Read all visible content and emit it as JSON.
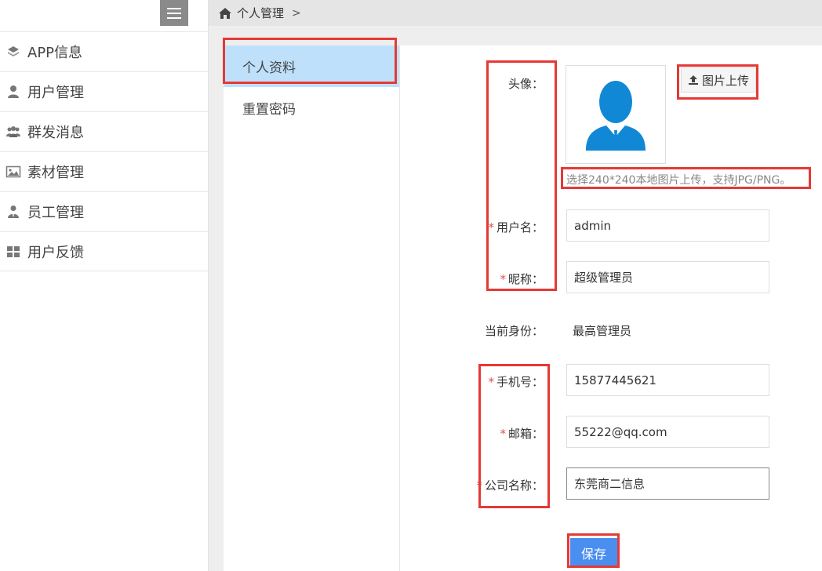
{
  "sidebar": {
    "items": [
      {
        "label": "APP信息",
        "icon": "layers-icon"
      },
      {
        "label": "用户管理",
        "icon": "user-icon"
      },
      {
        "label": "群发消息",
        "icon": "users-icon"
      },
      {
        "label": "素材管理",
        "icon": "image-icon"
      },
      {
        "label": "员工管理",
        "icon": "staff-icon"
      },
      {
        "label": "用户反馈",
        "icon": "grid-icon"
      }
    ]
  },
  "breadcrumb": {
    "current": "个人管理",
    "separator": ">"
  },
  "subnav": {
    "items": [
      {
        "label": "个人资料",
        "active": true
      },
      {
        "label": "重置密码",
        "active": false
      }
    ]
  },
  "form": {
    "avatar_label": "头像：",
    "upload_label": "图片上传",
    "upload_hint": "选择240*240本地图片上传，支持JPG/PNG。",
    "username_label": "用户名：",
    "username_value": "admin",
    "nickname_label": "昵称：",
    "nickname_value": "超级管理员",
    "role_label": "当前身份：",
    "role_value": "最高管理员",
    "phone_label": "手机号：",
    "phone_value": "15877445621",
    "email_label": "邮箱：",
    "email_value": "55222@qq.com",
    "company_label": "公司名称：",
    "company_value": "东莞商二信息",
    "required_mark": "*",
    "save_label": "保存"
  },
  "colors": {
    "accent": "#4a8ff0",
    "active_tab": "#bfe0fb",
    "annotation": "#e53935",
    "avatar": "#1188d6"
  }
}
